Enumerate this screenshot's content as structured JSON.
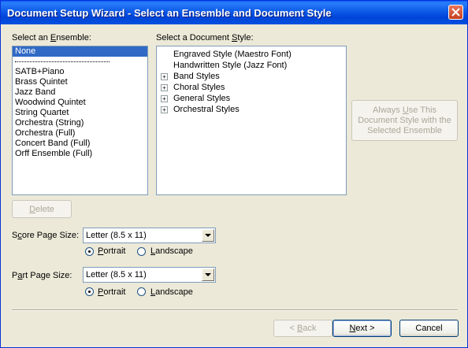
{
  "window": {
    "title": "Document Setup Wizard - Select an Ensemble and Document Style",
    "close_icon": "close-icon"
  },
  "ensemble": {
    "label_pre": "Select an ",
    "label_u": "E",
    "label_post": "nsemble:",
    "items": [
      {
        "label": "None",
        "selected": true
      },
      {
        "label": "---separator---"
      },
      {
        "label": "SATB+Piano"
      },
      {
        "label": "Brass Quintet"
      },
      {
        "label": "Jazz Band"
      },
      {
        "label": "Woodwind Quintet"
      },
      {
        "label": "String Quartet"
      },
      {
        "label": "Orchestra (String)"
      },
      {
        "label": "Orchestra (Full)"
      },
      {
        "label": "Concert Band (Full)"
      },
      {
        "label": "Orff Ensemble (Full)"
      }
    ],
    "delete_label_u": "D",
    "delete_label_rest": "elete"
  },
  "style": {
    "label_pre": "Select a Document ",
    "label_u": "S",
    "label_post": "tyle:",
    "items": [
      {
        "label": "Engraved Style (Maestro Font)",
        "expandable": false
      },
      {
        "label": "Handwritten Style (Jazz Font)",
        "expandable": false
      },
      {
        "label": "Band Styles",
        "expandable": true
      },
      {
        "label": "Choral Styles",
        "expandable": true
      },
      {
        "label": "General Styles",
        "expandable": true
      },
      {
        "label": "Orchestral Styles",
        "expandable": true
      }
    ],
    "always_use_line1_pre": "Always ",
    "always_use_line1_u": "U",
    "always_use_line1_post": "se This",
    "always_use_line2": "Document Style with the",
    "always_use_line3": "Selected Ensemble"
  },
  "score": {
    "label_pre": "S",
    "label_u": "c",
    "label_post": "ore Page Size:",
    "value": "Letter (8.5 x 11)",
    "portrait_u": "P",
    "portrait_rest": "ortrait",
    "landscape_u": "L",
    "landscape_rest": "andscape",
    "orientation": "portrait"
  },
  "part": {
    "label_pre": "P",
    "label_u": "a",
    "label_post": "rt Page Size:",
    "value": "Letter (8.5 x 11)",
    "portrait_u": "P",
    "portrait_rest": "ortrait",
    "landscape_u": "L",
    "landscape_rest": "andscape",
    "orientation": "portrait"
  },
  "footer": {
    "back_pre": "< ",
    "back_u": "B",
    "back_post": "ack",
    "next_u": "N",
    "next_post": "ext >",
    "cancel_label": "Cancel"
  }
}
